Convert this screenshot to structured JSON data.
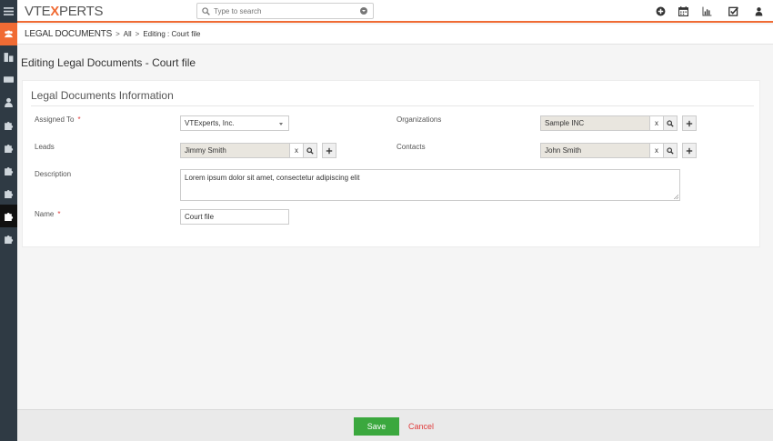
{
  "app": {
    "logo_prefix": "VTE",
    "logo_x": "X",
    "logo_suffix": "PERTS",
    "search_placeholder": "Type to search"
  },
  "breadcrumb": {
    "module": "LEGAL DOCUMENTS",
    "sep1": ">",
    "all": "All",
    "sep2": ">",
    "current": "Editing : Court file"
  },
  "page": {
    "title": "Editing Legal Documents - Court file"
  },
  "form": {
    "section_title": "Legal Documents Information",
    "required_mark": "*",
    "assigned_to": {
      "label": "Assigned To",
      "value": "VTExperts, Inc."
    },
    "organizations": {
      "label": "Organizations",
      "value": "Sample INC",
      "clear": "x"
    },
    "leads": {
      "label": "Leads",
      "value": "Jimmy Smith",
      "clear": "x"
    },
    "contacts": {
      "label": "Contacts",
      "value": "John Smith",
      "clear": "x"
    },
    "description": {
      "label": "Description",
      "value": "Lorem ipsum dolor sit amet, consectetur adipiscing elit"
    },
    "name": {
      "label": "Name",
      "value": "Court file"
    }
  },
  "footer": {
    "save_label": "Save",
    "cancel_label": "Cancel"
  },
  "colors": {
    "accent": "#f06b34",
    "rail": "#2f3a44",
    "save": "#3ba83e",
    "cancel": "#e03b3b"
  },
  "icons": {
    "top": [
      "plus-circle-icon",
      "calendar-icon",
      "bar-chart-icon",
      "check-square-icon",
      "user-icon"
    ],
    "rail": [
      "menu-icon",
      "users-icon",
      "building-icon",
      "id-card-icon",
      "person-icon",
      "puzzle-icon",
      "puzzle-icon",
      "puzzle-icon",
      "puzzle-icon",
      "puzzle-icon",
      "puzzle-icon"
    ]
  }
}
